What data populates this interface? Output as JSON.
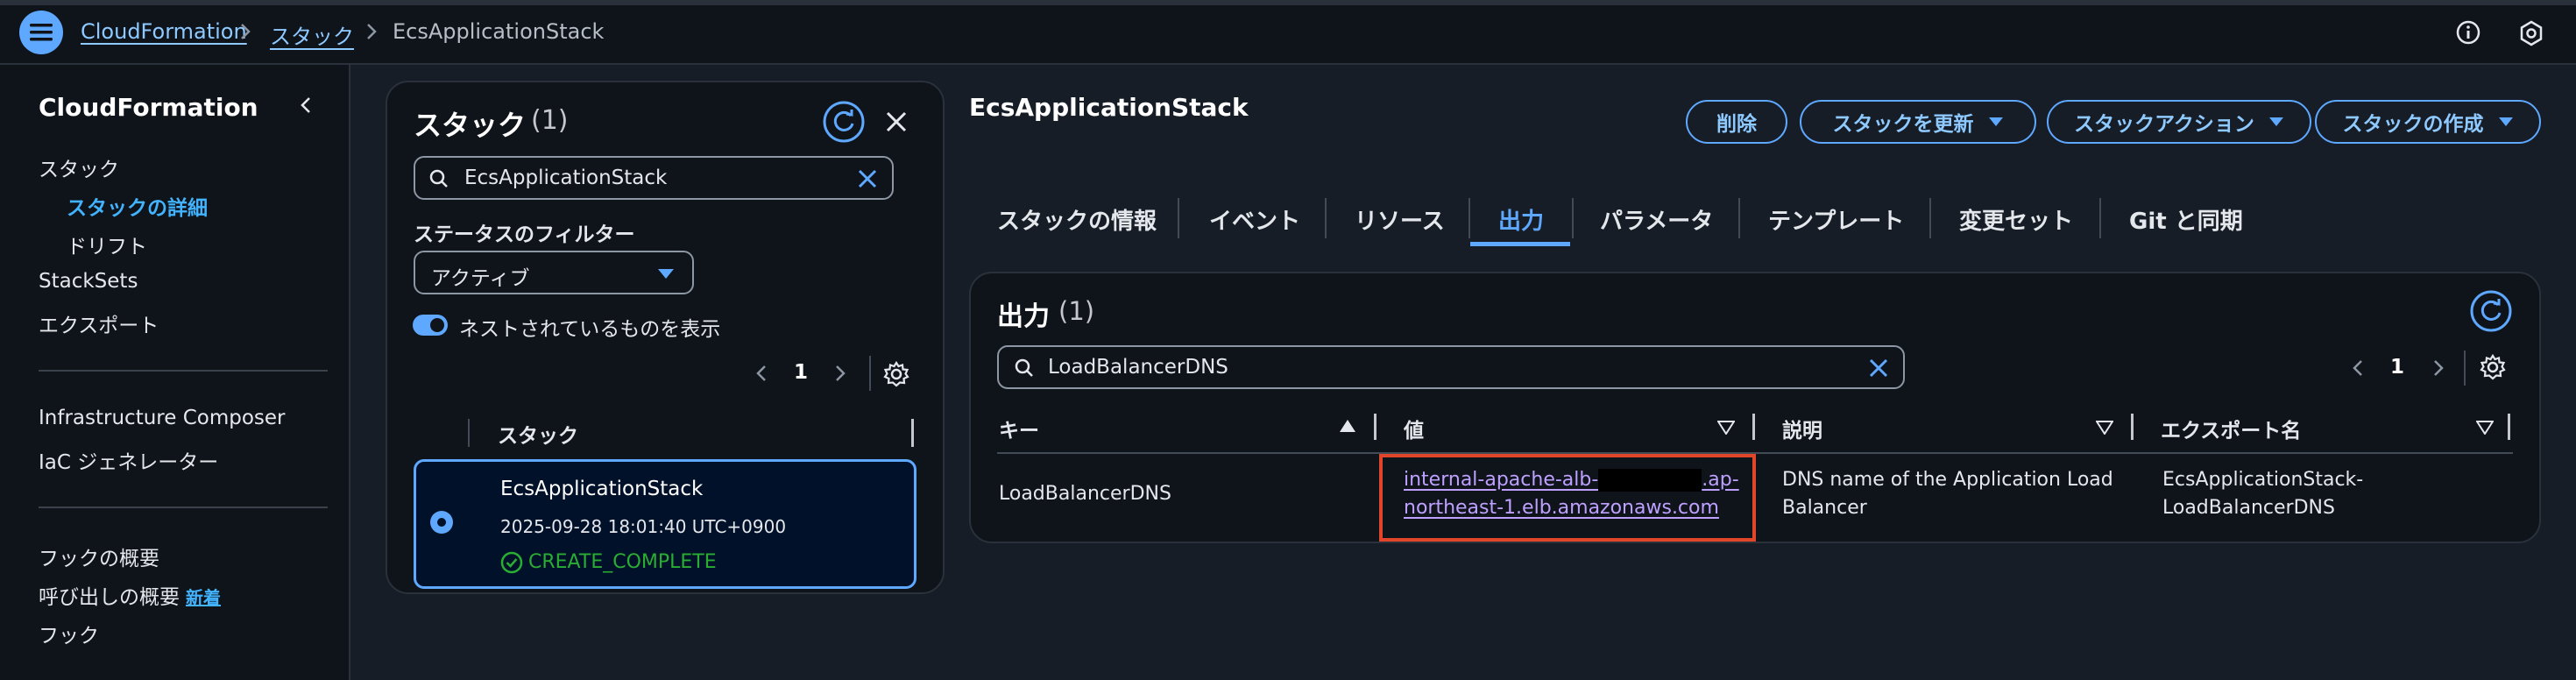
{
  "breadcrumb": {
    "root": "CloudFormation",
    "stacks": "スタック",
    "current": "EcsApplicationStack"
  },
  "sidebar": {
    "title": "CloudFormation",
    "items": {
      "stacks": "スタック",
      "stack_details": "スタックの詳細",
      "drift": "ドリフト",
      "stacksets": "StackSets",
      "exports": "エクスポート",
      "infra_composer": "Infrastructure Composer",
      "iac_generator": "IaC ジェネレーター",
      "hooks_overview": "フックの概要",
      "invocations_overview": "呼び出しの概要",
      "new_badge": "新着",
      "hooks": "フック"
    }
  },
  "stack_list": {
    "title": "スタック",
    "count": "(1)",
    "search_value": "EcsApplicationStack",
    "filter_label": "ステータスのフィルター",
    "filter_value": "アクティブ",
    "nested_toggle_label": "ネストされているものを表示",
    "page": "1",
    "column_header": "スタック",
    "item": {
      "name": "EcsApplicationStack",
      "date": "2025-09-28 18:01:40 UTC+0900",
      "status": "CREATE_COMPLETE"
    }
  },
  "detail": {
    "title": "EcsApplicationStack",
    "actions": {
      "delete": "削除",
      "update": "スタックを更新",
      "stack_actions": "スタックアクション",
      "create": "スタックの作成"
    },
    "tabs": {
      "info": "スタックの情報",
      "events": "イベント",
      "resources": "リソース",
      "outputs": "出力",
      "parameters": "パラメータ",
      "template": "テンプレート",
      "changesets": "変更セット",
      "git_sync": "Git と同期"
    },
    "outputs": {
      "title": "出力",
      "count": "(1)",
      "search_value": "LoadBalancerDNS",
      "page": "1",
      "columns": {
        "key": "キー",
        "value": "値",
        "description": "説明",
        "export_name": "エクスポート名"
      },
      "row": {
        "key": "LoadBalancerDNS",
        "value_line1_prefix": "internal-apache-alb-",
        "value_line1_suffix": ".ap-",
        "value_line2": "northeast-1.elb.amazonaws.com",
        "description_line1": "DNS name of the Application Load",
        "description_line2": "Balancer",
        "export_line1": "EcsApplicationStack-",
        "export_line2": "LoadBalancerDNS"
      }
    }
  },
  "colors": {
    "accent": "#5ea8ff",
    "link": "#8ec9ff",
    "success": "#29ad32",
    "highlight_box": "#e2462a",
    "background": "#161d26",
    "panel": "#0f141a"
  }
}
